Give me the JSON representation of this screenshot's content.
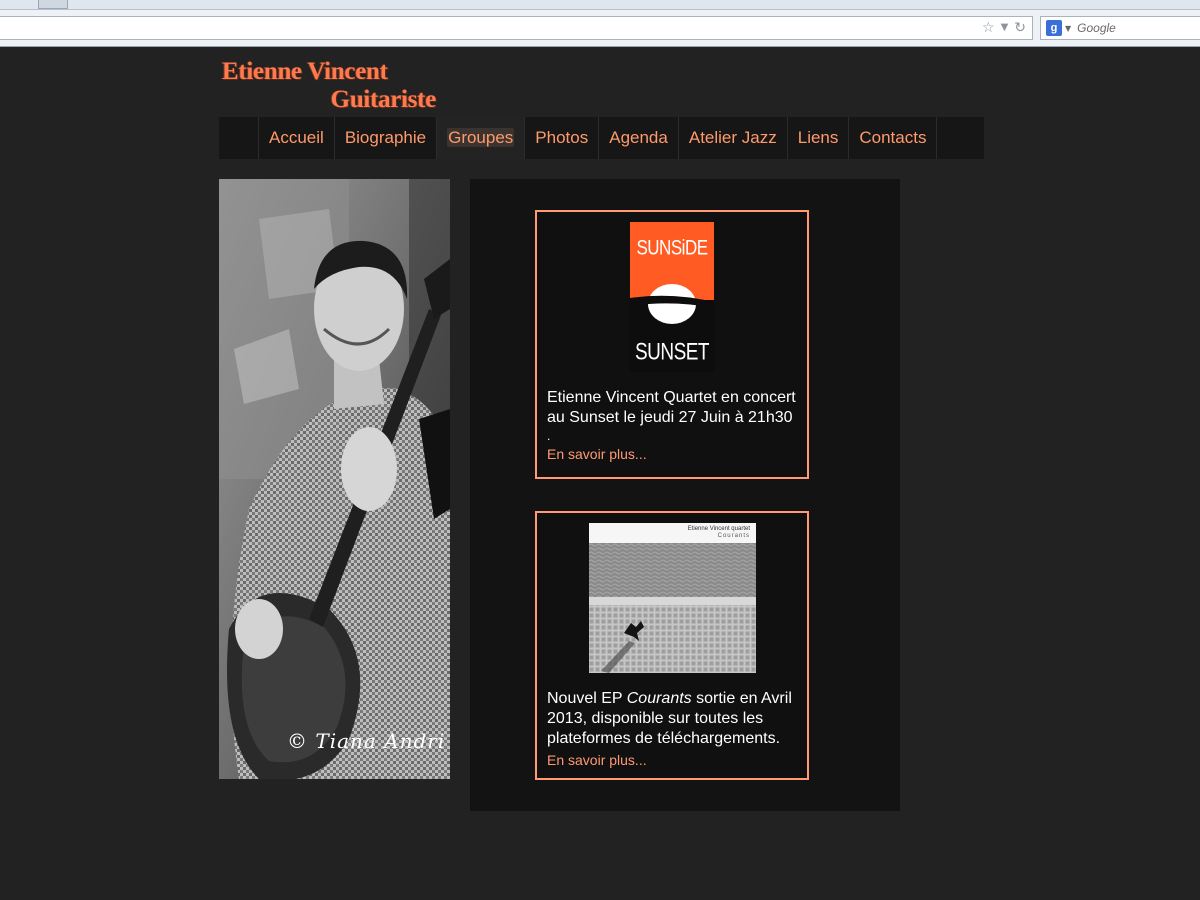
{
  "browser": {
    "search_placeholder": "Google",
    "search_engine_icon": "google-g-icon"
  },
  "site": {
    "logo_line1": "Etienne Vincent",
    "logo_line2": "Guitariste",
    "accent_color": "#ff9a6a"
  },
  "nav": {
    "items": [
      {
        "label": "Accueil"
      },
      {
        "label": "Biographie"
      },
      {
        "label": "Groupes",
        "active": true
      },
      {
        "label": "Photos"
      },
      {
        "label": "Agenda"
      },
      {
        "label": "Atelier Jazz"
      },
      {
        "label": "Liens"
      },
      {
        "label": "Contacts"
      }
    ]
  },
  "photo": {
    "credit": "© Tiana Andri"
  },
  "news": [
    {
      "poster_top": "SUNSiDE",
      "poster_bottom": "SUNSET",
      "text": "Etienne Vincent Quartet en concert au Sunset le jeudi 27 Juin à 21h30",
      "trailing": ".",
      "link": "En savoir plus..."
    },
    {
      "album_title": "Etienne Vincent quartet",
      "album_subtitle": "Courants",
      "text_before": "Nouvel EP ",
      "text_italic": "Courants",
      "text_after": " sortie en Avril 2013, disponible sur toutes les plateformes de téléchargements.",
      "link": "En savoir plus..."
    }
  ]
}
